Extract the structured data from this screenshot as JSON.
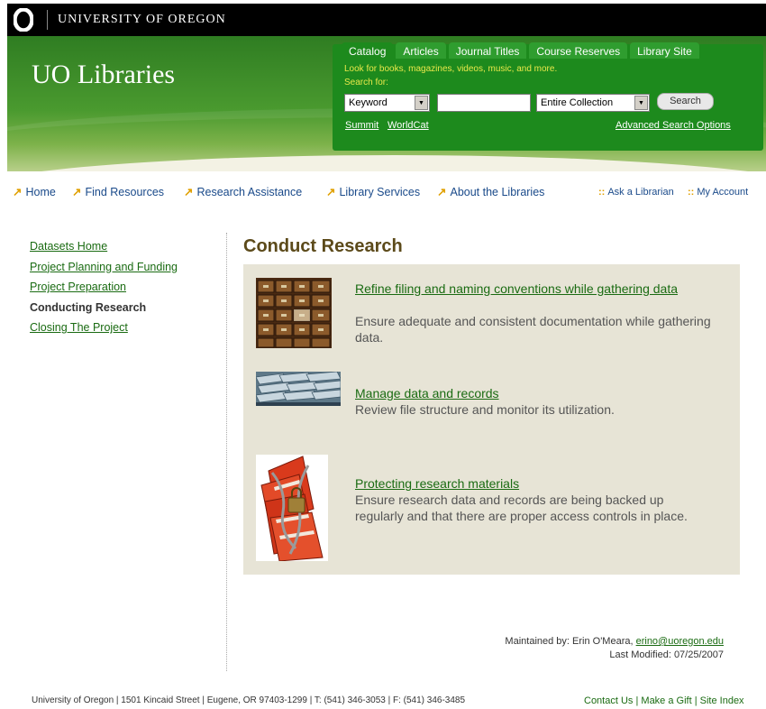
{
  "university_bar": {
    "name": "UNIVERSITY OF OREGON"
  },
  "header": {
    "site_title": "UO Libraries"
  },
  "search": {
    "tabs": [
      {
        "label": "Catalog",
        "active": true
      },
      {
        "label": "Articles",
        "active": false
      },
      {
        "label": "Journal Titles",
        "active": false
      },
      {
        "label": "Course Reserves",
        "active": false
      },
      {
        "label": "Library Site",
        "active": false
      }
    ],
    "description": "Look for books, magazines, videos, music, and more.",
    "search_for_label": "Search for:",
    "type_selected": "Keyword",
    "query_value": "",
    "scope_selected": "Entire Collection",
    "button_label": "Search",
    "links": {
      "summit": "Summit",
      "worldcat": "WorldCat",
      "advanced": "Advanced Search Options"
    }
  },
  "nav": {
    "items": [
      "Home",
      "Find Resources",
      "Research Assistance",
      "Library Services",
      "About the Libraries"
    ],
    "ask_librarian": "Ask a Librarian",
    "my_account": "My Account",
    "separator": "::"
  },
  "sidebar": {
    "items": [
      {
        "label": "Datasets Home",
        "current": false
      },
      {
        "label": "Project Planning and Funding",
        "current": false
      },
      {
        "label": "Project Preparation",
        "current": false
      },
      {
        "label": "Conducting Research",
        "current": true
      },
      {
        "label": "Closing The Project",
        "current": false
      }
    ]
  },
  "main": {
    "title": "Conduct Research",
    "items": [
      {
        "link": "Refine filing and naming conventions while gathering data",
        "description": "Ensure adequate and consistent documentation while gathering data."
      },
      {
        "link": "Manage data and records",
        "description": "Review file structure and monitor its utilization."
      },
      {
        "link": "Protecting research materials",
        "description": "Ensure research data and records are being backed up regularly and that there are proper access controls in place."
      }
    ]
  },
  "maintainer": {
    "label": "Maintained by: Erin O'Meara, ",
    "email": "erino@uoregon.edu",
    "last_modified": "Last Modified: 07/25/2007"
  },
  "footer": {
    "address": "University of Oregon | 1501 Kincaid Street | Eugene, OR 97403-1299 | T: (541) 346-3053 | F: (541) 346-3485",
    "links": [
      "Contact Us",
      "Make a Gift",
      "Site Index"
    ],
    "link_separator": " | "
  },
  "colors": {
    "header_green": "#2f7d22",
    "search_green": "#1d8a1d",
    "search_highlight": "#e8e84a",
    "link_green": "#1a6b12",
    "title_brown": "#5c4a1a",
    "panel_beige": "#e7e4d6",
    "nav_arrow": "#e0a000"
  },
  "icons": {
    "nav_arrow": "↗",
    "select_arrow": "▼"
  }
}
